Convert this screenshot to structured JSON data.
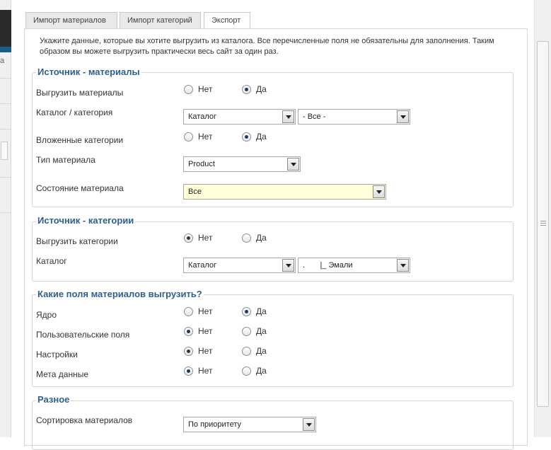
{
  "tabs": [
    {
      "label": "Импорт материалов"
    },
    {
      "label": "Импорт категорий"
    },
    {
      "label": "Экспорт"
    }
  ],
  "sidebar_fragment": {
    "label": "а"
  },
  "intro_text": "Укажите данные, которые вы хотите выгрузить из каталога. Все перечисленные поля не обязательны для заполнения. Таким образом вы можете выгрузить практически весь сайт за один раз.",
  "radio_labels": {
    "no": "Нет",
    "yes": "Да"
  },
  "sections": {
    "materials": {
      "title": "Источник - материалы",
      "export_label": "Выгрузить материалы",
      "export_value": "Да",
      "catalog_label": "Каталог / категория",
      "catalog_select": "Каталог",
      "category_select": "- Все -",
      "nested_label": "Вложенные категории",
      "nested_value": "Да",
      "type_label": "Тип материала",
      "type_select": "Product",
      "state_label": "Состояние материала",
      "state_select": "Все"
    },
    "categories": {
      "title": "Источник - категории",
      "export_label": "Выгрузить категории",
      "export_value": "Нет",
      "catalog_label": "Каталог",
      "catalog_select": "Каталог",
      "category_select": ".       |_ Эмали"
    },
    "fields": {
      "title": "Какие поля материалов выгрузить?",
      "core_label": "Ядро",
      "core_value": "Да",
      "custom_label": "Пользовательские поля",
      "custom_value": "Нет",
      "settings_label": "Настройки",
      "settings_value": "Нет",
      "meta_label": "Мета данные",
      "meta_value": "Нет"
    },
    "misc": {
      "title": "Разное",
      "sort_label": "Сортировка материалов",
      "sort_select": "По приоритету"
    }
  }
}
